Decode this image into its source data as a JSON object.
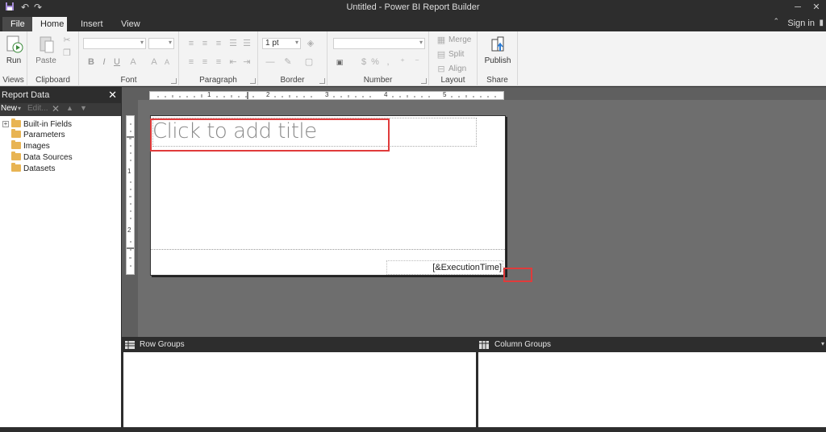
{
  "window": {
    "title": "Untitled - Power BI Report Builder",
    "icons": {
      "save": "save-icon",
      "undo": "undo-icon",
      "redo": "redo-icon"
    }
  },
  "tabs": {
    "file": "File",
    "home": "Home",
    "insert": "Insert",
    "view": "View",
    "signin": "Sign in"
  },
  "ribbon": {
    "groups": {
      "views": "Views",
      "clipboard": "Clipboard",
      "font": "Font",
      "paragraph": "Paragraph",
      "border": "Border",
      "number": "Number",
      "layout": "Layout",
      "share": "Share"
    },
    "buttons": {
      "run": "Run",
      "paste": "Paste",
      "merge": "Merge",
      "split": "Split",
      "align": "Align",
      "publish": "Publish"
    },
    "border_width": "1 pt",
    "font_style": {
      "bold": "B",
      "italic": "I",
      "underline": "U"
    },
    "number_symbols": {
      "currency": "$",
      "percent": "%",
      "comma": ","
    }
  },
  "report_data": {
    "title": "Report Data",
    "toolbar": {
      "new": "New",
      "edit": "Edit..."
    },
    "items": [
      "Built-in Fields",
      "Parameters",
      "Images",
      "Data Sources",
      "Datasets"
    ]
  },
  "report": {
    "title_placeholder": "Click to add title",
    "footer_expression": "[&ExecutionTime]",
    "ruler_numbers": [
      "1",
      "2",
      "3",
      "4",
      "5"
    ],
    "vertical_ruler_numbers": [
      "1",
      "2"
    ]
  },
  "grouping": {
    "row_groups": "Row Groups",
    "column_groups": "Column Groups"
  },
  "colors": {
    "chrome_dark": "#2d2d2d",
    "ribbon_bg": "#f3f3f3",
    "canvas_bg": "#6e6e6e",
    "highlight_red": "#e03b3b",
    "folder": "#e8b453"
  }
}
